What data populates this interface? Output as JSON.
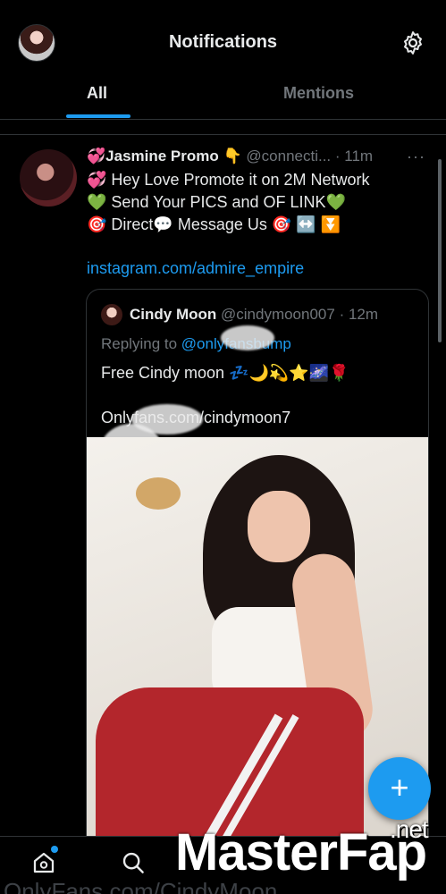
{
  "header": {
    "title": "Notifications",
    "tabs": [
      {
        "label": "All",
        "active": true
      },
      {
        "label": "Mentions",
        "active": false
      }
    ]
  },
  "tweet": {
    "name": "💞Jasmine Promo 👇",
    "handle": "@connecti...",
    "time": "· 11m",
    "more": "···",
    "lines": [
      "💞 Hey Love Promote it on 2M Network",
      "💚 Send Your PICS and OF LINK💚",
      "🎯 Direct💬 Message Us 🎯 ↔️ ⏬"
    ],
    "link": "instagram.com/admire_empire",
    "quote": {
      "name": "Cindy Moon",
      "handle": "@cindymoon007",
      "time": "· 12m",
      "replying_prefix": "Replying to ",
      "replying_mention": "@onlyfansbump",
      "text": "Free Cindy moon 💤🌙💫⭐🌌🌹",
      "link": "Onlyfans.com/cindymoon7"
    }
  },
  "fab": {
    "label": "+"
  },
  "watermark": {
    "text": "MasterFap",
    "suffix": ".net"
  },
  "bottom_ghost": "OnlyFans.com/CindyMoon",
  "colors": {
    "accent": "#1d9bf0",
    "background": "#000000",
    "muted": "#71767b"
  }
}
